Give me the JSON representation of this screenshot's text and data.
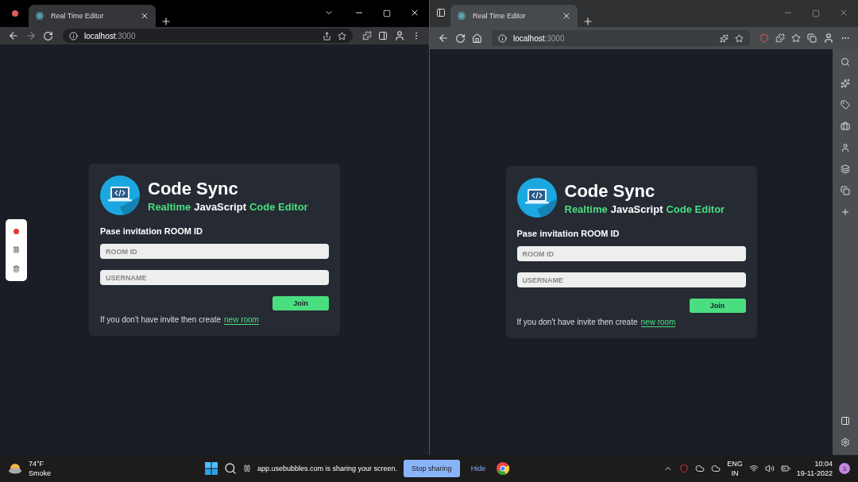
{
  "windows": [
    {
      "kind": "chrome",
      "tab_title": "Real Time Editor",
      "url_host": "localhost",
      "url_port": ":3000",
      "card": {
        "title": "Code Sync",
        "subtitle": [
          {
            "text": "Realtime",
            "accent": true
          },
          {
            "text": "JavaScript",
            "accent": false
          },
          {
            "text": "Code Editor",
            "accent": true
          }
        ],
        "label": "Pase invitation ROOM ID",
        "fields": [
          {
            "placeholder": "ROOM ID"
          },
          {
            "placeholder": "USERNAME"
          }
        ],
        "button": "Join",
        "footer": "If you don't have invite then create",
        "link": "new room"
      }
    },
    {
      "kind": "edge",
      "tab_title": "Real Time Editor",
      "url_host": "localhost",
      "url_port": ":3000",
      "card": {
        "title": "Code Sync",
        "subtitle": [
          {
            "text": "Realtime",
            "accent": true
          },
          {
            "text": "JavaScript",
            "accent": false
          },
          {
            "text": "Code Editor",
            "accent": true
          }
        ],
        "label": "Pase invitation ROOM ID",
        "fields": [
          {
            "placeholder": "ROOM ID"
          },
          {
            "placeholder": "USERNAME"
          }
        ],
        "button": "Join",
        "footer": "If you don't have invite then create",
        "link": "new room"
      }
    }
  ],
  "taskbar": {
    "weather": {
      "temp": "74°F",
      "condition": "Smoke"
    },
    "sharing": {
      "message": "app.usebubbles.com is sharing your screen.",
      "stop": "Stop sharing",
      "hide": "Hide"
    },
    "lang": "ENG",
    "region": "IN",
    "time": "10:04",
    "date": "19-11-2022",
    "badge": "3"
  }
}
